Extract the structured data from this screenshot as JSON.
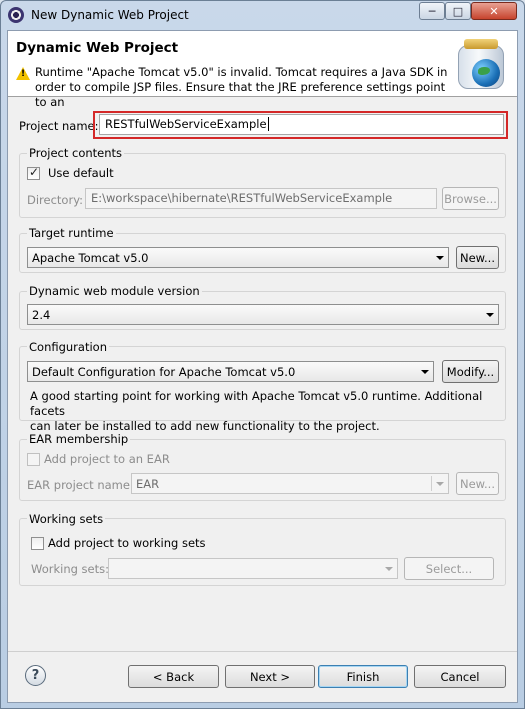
{
  "window": {
    "title": "New Dynamic Web Project",
    "minimize": "─",
    "maximize": "□",
    "close": "✕"
  },
  "header": {
    "title": "Dynamic Web Project",
    "warning_line1": "Runtime \"Apache Tomcat v5.0\" is invalid. Tomcat requires a Java SDK in",
    "warning_line2": "order to compile JSP files. Ensure that the JRE preference settings point to an"
  },
  "project_name": {
    "label": "Project name:",
    "value": "RESTfulWebServiceExample"
  },
  "project_contents": {
    "title": "Project contents",
    "use_default_label": "Use default",
    "use_default_checked": true,
    "directory_label": "Directory:",
    "directory_value": "E:\\workspace\\hibernate\\RESTfulWebServiceExample",
    "browse_label": "Browse..."
  },
  "target_runtime": {
    "title": "Target runtime",
    "selected": "Apache Tomcat v5.0",
    "new_label": "New..."
  },
  "module_version": {
    "title": "Dynamic web module version",
    "selected": "2.4"
  },
  "configuration": {
    "title": "Configuration",
    "selected": "Default Configuration for Apache Tomcat v5.0",
    "modify_label": "Modify...",
    "description_line1": "A good starting point for working with Apache Tomcat v5.0 runtime. Additional facets",
    "description_line2": "can later be installed to add new functionality to the project."
  },
  "ear_membership": {
    "title": "EAR membership",
    "add_label": "Add project to an EAR",
    "project_name_label": "EAR project name:",
    "project_name_value": "EAR",
    "new_label": "New..."
  },
  "working_sets": {
    "title": "Working sets",
    "add_label": "Add project to working sets",
    "sets_label": "Working sets:",
    "sets_value": "",
    "select_label": "Select..."
  },
  "footer": {
    "help": "?",
    "back_label": "< Back",
    "next_label": "Next >",
    "finish_label": "Finish",
    "cancel_label": "Cancel"
  }
}
